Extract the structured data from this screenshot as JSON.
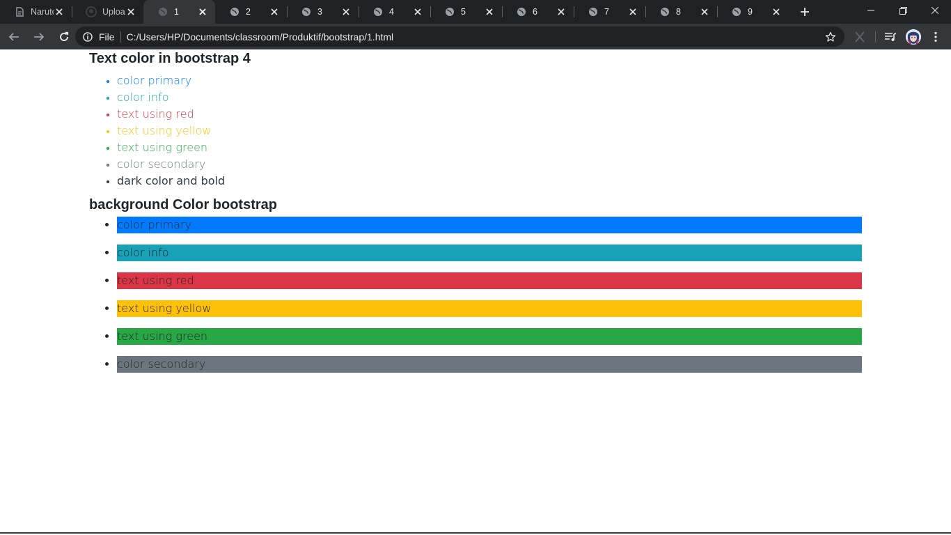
{
  "browser": {
    "tabs": [
      {
        "title": "Naruto",
        "icon": "document-icon",
        "active": false
      },
      {
        "title": "Upload",
        "icon": "github-icon",
        "active": false
      },
      {
        "title": "1",
        "icon": "globe-icon",
        "active": true
      },
      {
        "title": "2",
        "icon": "globe-icon",
        "active": false
      },
      {
        "title": "3",
        "icon": "globe-icon",
        "active": false
      },
      {
        "title": "4",
        "icon": "globe-icon",
        "active": false
      },
      {
        "title": "5",
        "icon": "globe-icon",
        "active": false
      },
      {
        "title": "6",
        "icon": "globe-icon",
        "active": false
      },
      {
        "title": "7",
        "icon": "globe-icon",
        "active": false
      },
      {
        "title": "8",
        "icon": "globe-icon",
        "active": false
      },
      {
        "title": "9",
        "icon": "globe-icon",
        "active": false
      }
    ],
    "omnibox": {
      "scheme_label": "File",
      "url": "C:/Users/HP/Documents/classroom/Produktif/bootstrap/1.html"
    }
  },
  "page": {
    "heading1": "Text color in bootstrap 4",
    "text_items": [
      {
        "label": "color primary",
        "color": "#007bff"
      },
      {
        "label": "color info",
        "color": "#17a2b8"
      },
      {
        "label": "text using red",
        "color": "#dc3545"
      },
      {
        "label": "text using yellow",
        "color": "#ffc107"
      },
      {
        "label": "text using green",
        "color": "#28a745"
      },
      {
        "label": "color secondary",
        "color": "#6c757d"
      },
      {
        "label": "dark color and bold",
        "color": "#343a40"
      }
    ],
    "heading2": "background Color bootstrap",
    "bg_items": [
      {
        "label": "color primary",
        "color": "#007bff"
      },
      {
        "label": "color info",
        "color": "#17a2b8"
      },
      {
        "label": "text using red",
        "color": "#dc3545"
      },
      {
        "label": "text using yellow",
        "color": "#ffc107"
      },
      {
        "label": "text using green",
        "color": "#28a745"
      },
      {
        "label": "color secondary",
        "color": "#6c757d"
      }
    ]
  }
}
